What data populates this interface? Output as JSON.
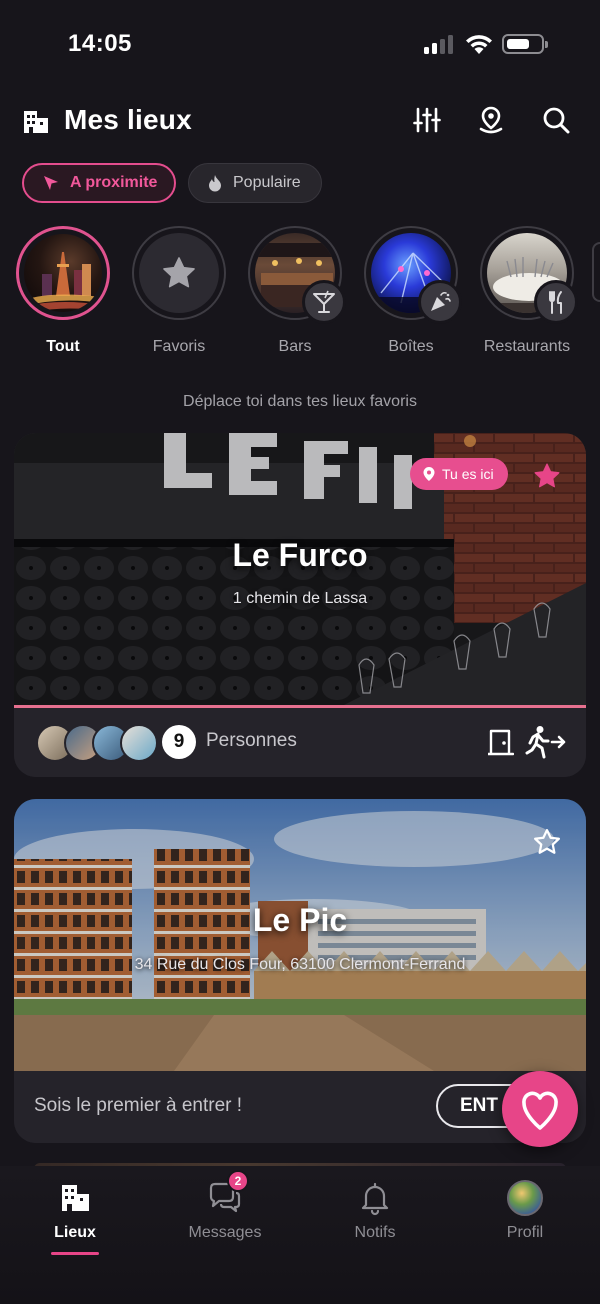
{
  "status_bar": {
    "time": "14:05"
  },
  "header": {
    "title": "Mes lieux"
  },
  "chips": {
    "nearby": "A proximite",
    "popular": "Populaire"
  },
  "categories": [
    {
      "label": "Tout",
      "selected": true
    },
    {
      "label": "Favoris",
      "selected": false
    },
    {
      "label": "Bars",
      "selected": false
    },
    {
      "label": "Boîtes",
      "selected": false
    },
    {
      "label": "Restaurants",
      "selected": false
    }
  ],
  "hint": "Déplace toi dans tes lieux favoris",
  "venues": [
    {
      "name": "Le Furco",
      "address": "1 chemin de Lassa",
      "badge": "Tu es ici",
      "favorite": true,
      "people_count": "9",
      "people_label": "Personnes"
    },
    {
      "name": "Le Pic",
      "address": "34 Rue du Clos Four, 63100 Clermont-Ferrand",
      "favorite": false,
      "empty_label": "Sois le premier à entrer !",
      "enter_label": "ENT"
    }
  ],
  "bottom_nav": {
    "places": "Lieux",
    "messages": "Messages",
    "messages_badge": "2",
    "notifications": "Notifs",
    "profile": "Profil"
  },
  "colors": {
    "accent": "#e74588",
    "background": "#17151b",
    "card": "#26242b"
  },
  "icons": {
    "header": "building-icon",
    "filters": "sliders-icon",
    "location": "map-pin-icon",
    "search": "search-icon",
    "fab": "heart-pin-icon"
  }
}
